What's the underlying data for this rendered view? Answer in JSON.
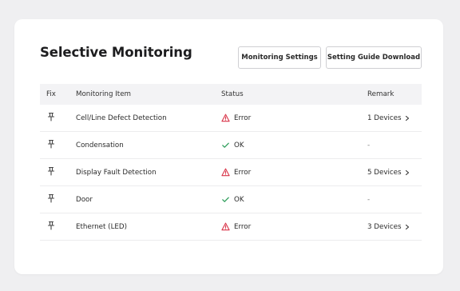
{
  "panel": {
    "title": "Selective Monitoring",
    "buttons": {
      "monitoring_settings": "Monitoring Settings",
      "setting_guide_download": "Setting Guide Download"
    }
  },
  "table": {
    "headers": {
      "fix": "Fix",
      "item": "Monitoring Item",
      "status": "Status",
      "remark": "Remark"
    },
    "rows": [
      {
        "item": "Cell/Line Defect Detection",
        "status": "Error",
        "status_icon": "warning-icon",
        "remark": "1 Devices",
        "remark_link": true
      },
      {
        "item": "Condensation",
        "status": "OK",
        "status_icon": "check-icon",
        "remark": "-",
        "remark_link": false
      },
      {
        "item": "Display Fault Detection",
        "status": "Error",
        "status_icon": "warning-icon",
        "remark": "5 Devices",
        "remark_link": true
      },
      {
        "item": "Door",
        "status": "OK",
        "status_icon": "check-icon",
        "remark": "-",
        "remark_link": false
      },
      {
        "item": "Ethernet (LED)",
        "status": "Error",
        "status_icon": "warning-icon",
        "remark": "3 Devices",
        "remark_link": true
      }
    ]
  },
  "colors": {
    "error": "#d9364a",
    "ok": "#2e9e5b",
    "card": "#ffffff",
    "page_bg": "#efeff1",
    "header_bg": "#f3f3f5"
  }
}
